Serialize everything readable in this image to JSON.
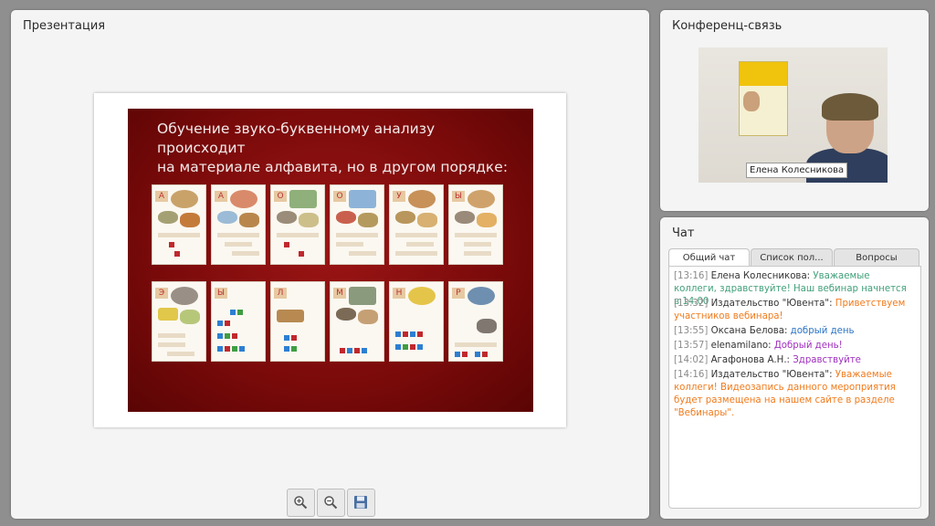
{
  "presentation": {
    "title": "Презентация",
    "slide": {
      "heading": "Обучение звуко-буквенному анализу происходит\nна материале алфавита, но в другом порядке:",
      "cards_row1": [
        "А",
        "А",
        "О",
        "О",
        "У",
        "Ы"
      ],
      "cards_row2": [
        "Э",
        "Ы",
        "Л",
        "М",
        "Н",
        "Р"
      ]
    },
    "toolbar": {
      "zoom_in_icon": "zoom-in-icon",
      "zoom_out_icon": "zoom-out-icon",
      "save_icon": "save-icon"
    }
  },
  "conference": {
    "title": "Конференц-связь",
    "caption": "Елена Колесникова"
  },
  "chat": {
    "title": "Чат",
    "tabs": [
      "Общий чат",
      "Список пол...",
      "Вопросы"
    ],
    "messages": [
      {
        "time": "[13:16]",
        "author": "Елена Колесникова:",
        "text": "Уважаемые коллеги, здравствуйте! Наш вебинар начнется в 14.00",
        "color": "#41a07a"
      },
      {
        "time": "[13:32]",
        "author": "Издательство \"Ювента\":",
        "text": "Приветствуем участников вебинара!",
        "color": "#f07b1d"
      },
      {
        "time": "[13:55]",
        "author": "Оксана Белова:",
        "text": "добрый день",
        "color": "#2a74c5"
      },
      {
        "time": "[13:57]",
        "author": "elenamilano:",
        "text": "Добрый день!",
        "color": "#a02fbf"
      },
      {
        "time": "[14:02]",
        "author": "Агафонова А.Н.:",
        "text": "Здравствуйте",
        "color": "#a02fbf"
      },
      {
        "time": "[14:16]",
        "author": "Издательство \"Ювента\":",
        "text": "Уважаемые коллеги! Видеозапись данного мероприятия будет размещена на нашем сайте в разделе \"Вебинары\".",
        "color": "#f07b1d"
      }
    ]
  }
}
